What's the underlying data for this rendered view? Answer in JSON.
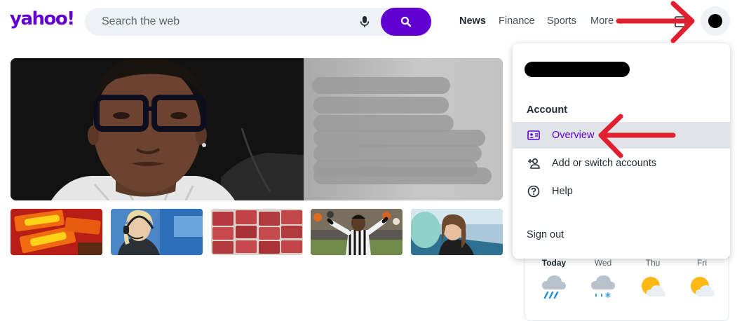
{
  "header": {
    "logo": "yahoo!",
    "search": {
      "placeholder": "Search the web"
    },
    "nav": [
      {
        "label": "News",
        "active": true
      },
      {
        "label": "Finance",
        "active": false
      },
      {
        "label": "Sports",
        "active": false
      },
      {
        "label": "More ⌄",
        "active": false
      }
    ]
  },
  "account_menu": {
    "heading": "Account",
    "items": [
      {
        "label": "Overview",
        "icon": "id-card-icon",
        "active": true
      },
      {
        "label": "Add or switch accounts",
        "icon": "add-user-icon",
        "active": false
      },
      {
        "label": "Help",
        "icon": "help-icon",
        "active": false
      }
    ],
    "sign_out": "Sign out"
  },
  "weather": {
    "days": [
      {
        "label": "Today",
        "icon": "rain-icon"
      },
      {
        "label": "Wed",
        "icon": "sleet-icon"
      },
      {
        "label": "Thu",
        "icon": "partly-cloudy-icon"
      },
      {
        "label": "Fri",
        "icon": "partly-cloudy-icon"
      }
    ]
  },
  "colors": {
    "brand": "#6001d2",
    "annotation": "#e0202f",
    "menu_highlight": "#e0e4e9"
  }
}
